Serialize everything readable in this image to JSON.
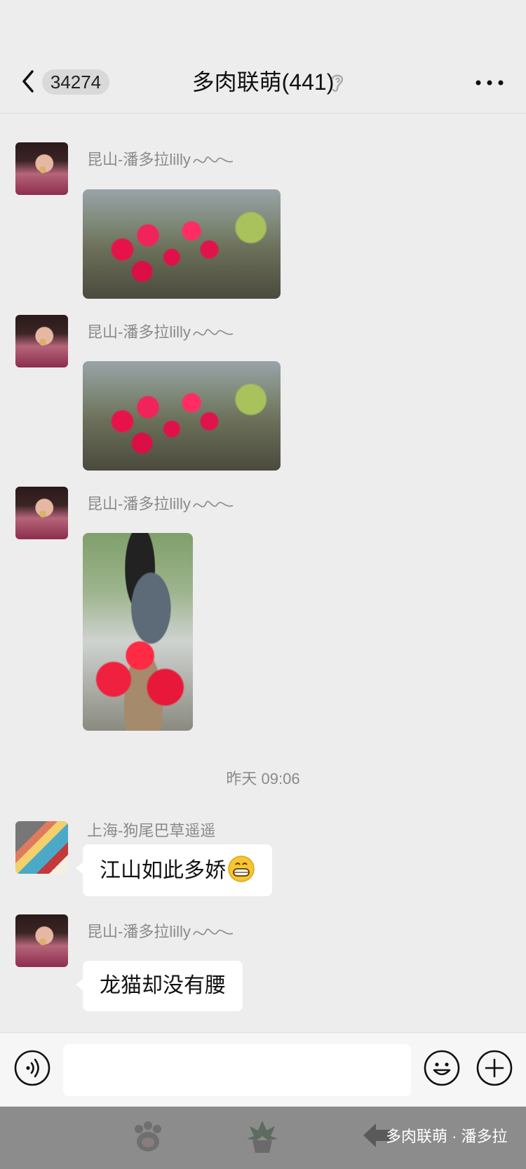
{
  "header": {
    "unread_count": "34274",
    "chat_title": "多肉联萌(441)",
    "back_icon": "chevron-left-icon",
    "mute_icon": "ear-icon",
    "more_icon": "more-horizontal-icon"
  },
  "messages": [
    {
      "sender": "昆山-潘多拉lilly",
      "type": "image"
    },
    {
      "sender": "昆山-潘多拉lilly",
      "type": "image"
    },
    {
      "sender": "昆山-潘多拉lilly",
      "type": "image"
    }
  ],
  "time_divider": "昨天 09:06",
  "messages_after": [
    {
      "sender": "上海-狗尾巴草遥遥",
      "text": "江山如此多娇"
    },
    {
      "sender": "昆山-潘多拉lilly",
      "text": "龙猫却没有腰"
    }
  ],
  "input": {
    "placeholder": "",
    "voice_icon": "voice-icon",
    "emoji_icon": "emoji-icon",
    "plus_icon": "plus-icon"
  },
  "watermark": "多肉联萌 · 潘多拉",
  "colors": {
    "background": "#ededed",
    "bubble": "#ffffff",
    "meta_text": "#8a8a8a",
    "bottom_bar": "#8c8c8c"
  }
}
